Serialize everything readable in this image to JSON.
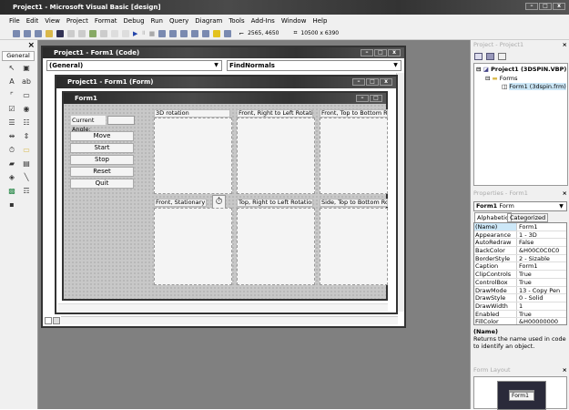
{
  "app": {
    "title": "Project1 - Microsoft Visual Basic [design]"
  },
  "menu": [
    "File",
    "Edit",
    "View",
    "Project",
    "Format",
    "Debug",
    "Run",
    "Query",
    "Diagram",
    "Tools",
    "Add-Ins",
    "Window",
    "Help"
  ],
  "toolbar": {
    "position": "2565, 4650",
    "size": "10500 x 6390"
  },
  "toolbox": {
    "tab": "General",
    "close": "×",
    "tools": [
      "pointer-icon",
      "picturebox-icon",
      "label-icon",
      "textbox-icon",
      "frame-icon",
      "commandbutton-icon",
      "checkbox-icon",
      "optionbutton-icon",
      "combobox-icon",
      "listbox-icon",
      "hscrollbar-icon",
      "vscrollbar-icon",
      "timer-icon",
      "drivelistbox-icon",
      "dirlistbox-icon",
      "filelistbox-icon",
      "shape-icon",
      "line-icon",
      "image-icon",
      "data-icon",
      "ole-icon"
    ]
  },
  "code_window": {
    "title": "Project1 - Form1 (Code)",
    "object": "(General)",
    "procedure": "FindNormals"
  },
  "form_window": {
    "title": "Project1 - Form1 (Form)"
  },
  "form": {
    "caption": "Form1",
    "angle_label": "Current Angle:",
    "buttons": [
      "Move",
      "Start",
      "Stop",
      "Reset",
      "Quit"
    ],
    "pictures": [
      "3D rotation",
      "Front, Right to Left Rotation",
      "Front, Top to Bottom Rotation",
      "Front, Stationary",
      "Top, Right to Left Rotation",
      "Side, Top to Bottom Rotation"
    ]
  },
  "project": {
    "title": "Project - Project1",
    "root": "Project1 (3DSPIN.VBP)",
    "folder": "Forms",
    "item": "Form1 (3dspin.frm)"
  },
  "properties": {
    "title": "Properties - Form1",
    "object": "Form1",
    "object_type": "Form",
    "tabs": [
      "Alphabetic",
      "Categorized"
    ],
    "rows": [
      [
        "(Name)",
        "Form1"
      ],
      [
        "Appearance",
        "1 - 3D"
      ],
      [
        "AutoRedraw",
        "False"
      ],
      [
        "BackColor",
        "&H00C0C0C0"
      ],
      [
        "BorderStyle",
        "2 - Sizable"
      ],
      [
        "Caption",
        "Form1"
      ],
      [
        "ClipControls",
        "True"
      ],
      [
        "ControlBox",
        "True"
      ],
      [
        "DrawMode",
        "13 - Copy Pen"
      ],
      [
        "DrawStyle",
        "0 - Solid"
      ],
      [
        "DrawWidth",
        "1"
      ],
      [
        "Enabled",
        "True"
      ],
      [
        "FillColor",
        "&H00000000"
      ]
    ],
    "desc_title": "(Name)",
    "desc": "Returns the name used in code to identify an object."
  },
  "layout": {
    "title": "Form Layout",
    "form": "Form1"
  }
}
